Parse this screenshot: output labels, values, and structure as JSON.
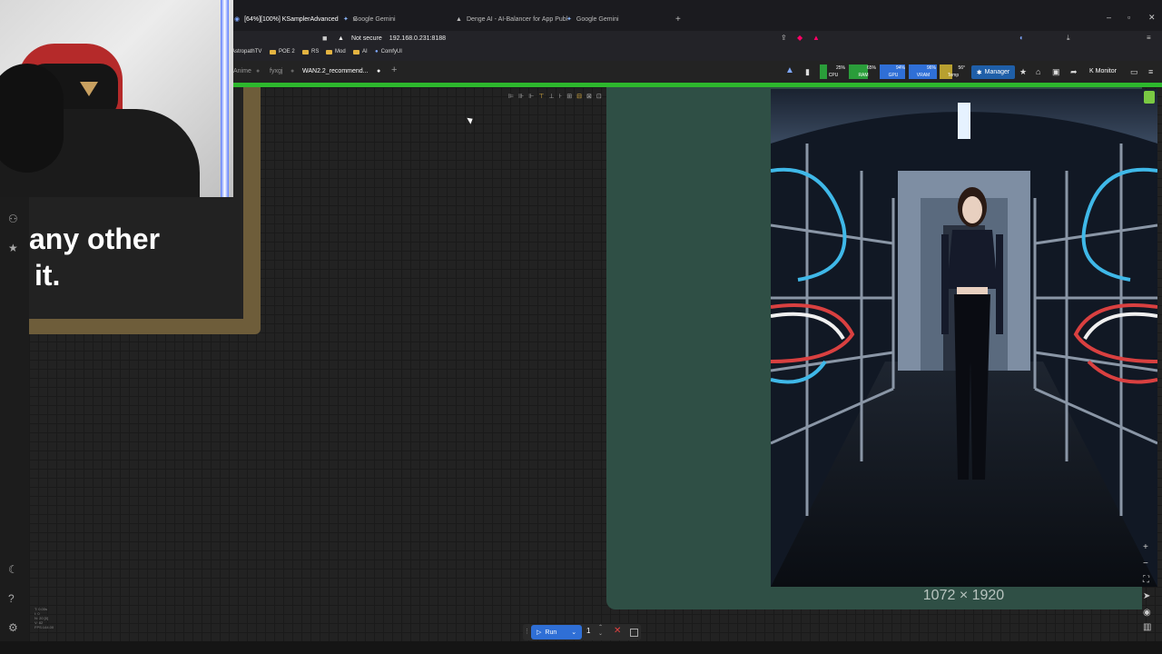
{
  "browser": {
    "tabs": [
      {
        "label": "[64%][100%] KSamplerAdvanced",
        "active": true
      },
      {
        "label": "Google Gemini",
        "active": false
      },
      {
        "label": "Denge AI - AI-Balancer for App Publ",
        "active": false
      },
      {
        "label": "Google Gemini",
        "active": false
      }
    ],
    "security_label": "Not secure",
    "url": "192.168.0.231:8188",
    "bookmarks": [
      "AstropathTV",
      "POE 2",
      "RS",
      "Mod",
      "AI",
      "ComfyUI"
    ]
  },
  "comfy": {
    "workflow_tabs": [
      "Anime",
      "fyxgj",
      "WAN2.2_recommend..."
    ],
    "stats": [
      {
        "label": "CPU",
        "pct": "25%",
        "color": "#2a9d3a"
      },
      {
        "label": "RAM",
        "pct": "65%",
        "color": "#2a9d3a"
      },
      {
        "label": "GPU",
        "pct": "94%",
        "color": "#2f6fd6"
      },
      {
        "label": "VRAM",
        "pct": "96%",
        "color": "#2f6fd6"
      },
      {
        "label": "Temp",
        "pct": "56°",
        "color": "#b8a030"
      }
    ],
    "manager_label": "Manager",
    "monitor_label": "Monitor"
  },
  "note_text": [
    "any other",
    "it."
  ],
  "preview": {
    "dimensions": "1072 × 1920"
  },
  "run": {
    "label": "Run",
    "count": "1"
  },
  "canvas_stats": [
    "T: 0.00s",
    "I: 0",
    "N: 20 [0]",
    "V: 82",
    "FPS:144.00"
  ]
}
